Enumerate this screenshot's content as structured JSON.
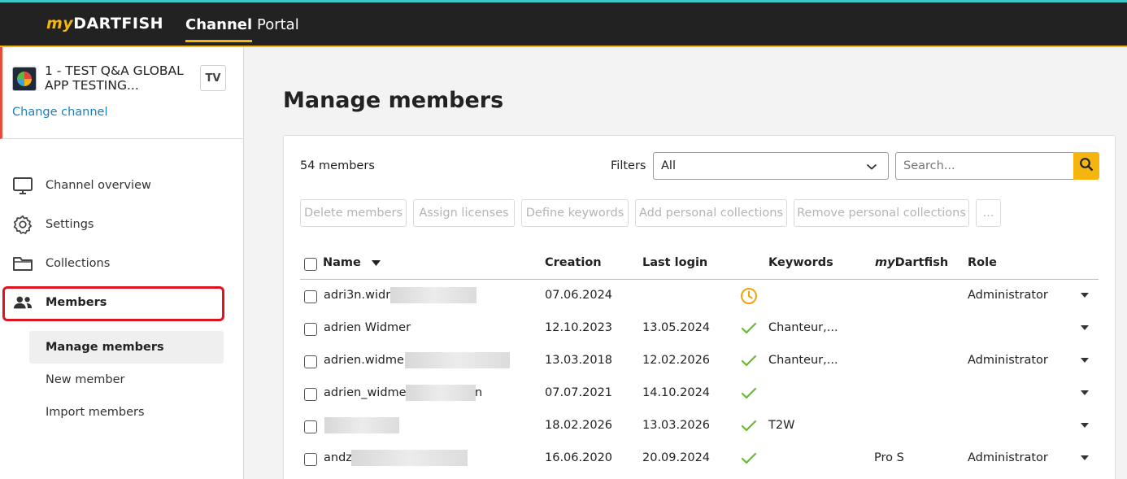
{
  "app": {
    "logo_my": "my",
    "logo_brand": "DARTFISH"
  },
  "nav": {
    "tabs": [
      {
        "label": "Channel",
        "active": true
      },
      {
        "label": "Portal",
        "active": false
      }
    ]
  },
  "channel": {
    "name": "1 - TEST Q&A GLOBAL APP TESTING...",
    "badge": "TV",
    "change_label": "Change channel"
  },
  "sidebar": {
    "items": [
      {
        "label": "Channel overview",
        "icon": "monitor-icon"
      },
      {
        "label": "Settings",
        "icon": "gear-icon"
      },
      {
        "label": "Collections",
        "icon": "folder-icon"
      },
      {
        "label": "Members",
        "icon": "users-icon",
        "active": true
      }
    ],
    "subitems": [
      {
        "label": "Manage members",
        "active": true
      },
      {
        "label": "New member"
      },
      {
        "label": "Import members"
      }
    ]
  },
  "main": {
    "title": "Manage members",
    "count_label": "54  members",
    "filters_label": "Filters",
    "filter_value": "All",
    "search_placeholder": "Search...",
    "actions": [
      "Delete members",
      "Assign licenses",
      "Define keywords",
      "Add personal collections",
      "Remove personal collections",
      "..."
    ],
    "columns": {
      "name": "Name",
      "creation": "Creation",
      "last_login": "Last login",
      "keywords": "Keywords",
      "mydartfish_my": "my",
      "mydartfish_rest": "Dartfish",
      "role": "Role"
    },
    "rows": [
      {
        "name": "adri3n.widm",
        "creation": "07.06.2024",
        "last_login": "",
        "status": "pending-clock-icon",
        "keywords": "",
        "mydartfish": "",
        "role": "Administrator"
      },
      {
        "name": "adrien Widmer",
        "creation": "12.10.2023",
        "last_login": "13.05.2024",
        "status": "check-icon",
        "keywords": "Chanteur,...",
        "mydartfish": "",
        "role": ""
      },
      {
        "name": "adrien.widmer",
        "creation": "13.03.2018",
        "last_login": "12.02.2026",
        "status": "check-icon",
        "keywords": "Chanteur,...",
        "mydartfish": "",
        "role": "Administrator"
      },
      {
        "name": "adrien_widmer",
        "name_suffix": "n",
        "creation": "07.07.2021",
        "last_login": "14.10.2024",
        "status": "check-icon",
        "keywords": "",
        "mydartfish": "",
        "role": ""
      },
      {
        "name": "",
        "creation": "18.02.2026",
        "last_login": "13.03.2026",
        "status": "check-icon",
        "keywords": "T2W",
        "mydartfish": "",
        "role": ""
      },
      {
        "name": "andz",
        "creation": "16.06.2020",
        "last_login": "20.09.2024",
        "status": "check-icon",
        "keywords": "",
        "mydartfish": "Pro S",
        "role": "Administrator"
      }
    ]
  },
  "colors": {
    "accent": "#f5b50e",
    "topbar": "#222222",
    "highlight": "#dd1320",
    "link": "#1b7fbf",
    "check": "#66bb2a"
  }
}
